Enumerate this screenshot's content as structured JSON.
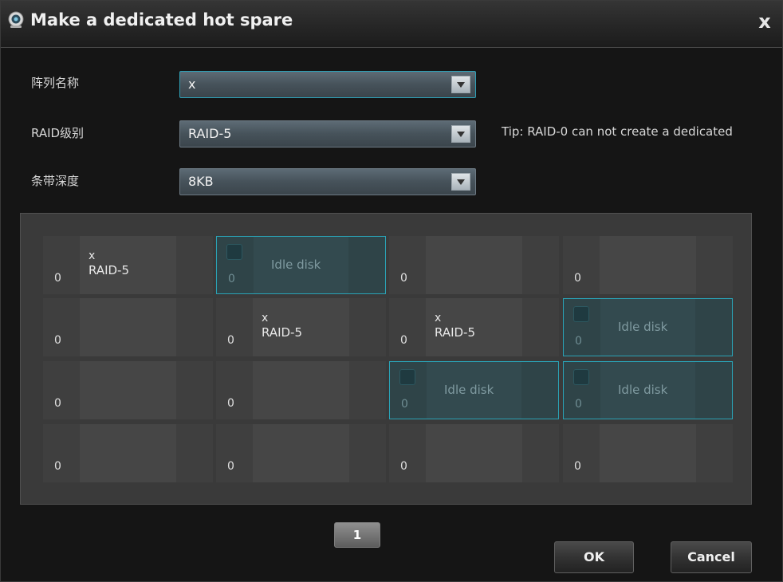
{
  "dialog": {
    "title": "Make a dedicated hot spare",
    "close_label": "x"
  },
  "form": {
    "array_name": {
      "label": "阵列名称",
      "value": "x"
    },
    "raid_level": {
      "label": "RAID级别",
      "value": "RAID-5"
    },
    "stripe_depth": {
      "label": "条带深度",
      "value": "8KB"
    },
    "tip": "Tip: RAID-0 can not create a dedicated"
  },
  "disks": [
    {
      "type": "array",
      "num": "0",
      "name": "x",
      "level": "RAID-5"
    },
    {
      "type": "idle",
      "num": "0",
      "label": "Idle disk"
    },
    {
      "type": "empty",
      "num": "0"
    },
    {
      "type": "empty",
      "num": "0"
    },
    {
      "type": "empty",
      "num": "0"
    },
    {
      "type": "array",
      "num": "0",
      "name": "x",
      "level": "RAID-5"
    },
    {
      "type": "array",
      "num": "0",
      "name": "x",
      "level": "RAID-5"
    },
    {
      "type": "idle",
      "num": "0",
      "label": "Idle disk"
    },
    {
      "type": "empty",
      "num": "0"
    },
    {
      "type": "empty",
      "num": "0"
    },
    {
      "type": "idle",
      "num": "0",
      "label": "Idle disk"
    },
    {
      "type": "idle",
      "num": "0",
      "label": "Idle disk"
    },
    {
      "type": "empty",
      "num": "0"
    },
    {
      "type": "empty",
      "num": "0"
    },
    {
      "type": "empty",
      "num": "0"
    },
    {
      "type": "empty",
      "num": "0"
    }
  ],
  "pagination": {
    "current": "1"
  },
  "buttons": {
    "ok": "OK",
    "cancel": "Cancel"
  },
  "colors": {
    "idle_border": "#2aa2b5",
    "dialog_bg": "#151515",
    "grid_bg": "#3a3a3a"
  }
}
